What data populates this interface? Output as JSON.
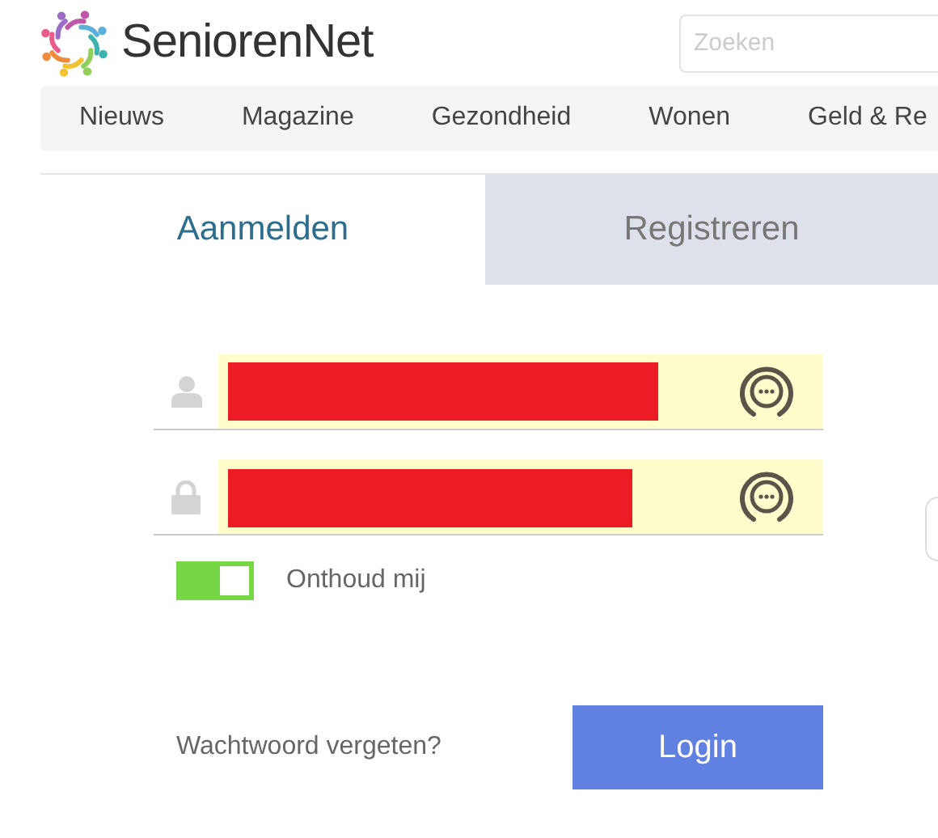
{
  "header": {
    "brand": "SeniorenNet",
    "search": {
      "placeholder": "Zoeken"
    }
  },
  "nav": [
    "Nieuws",
    "Magazine",
    "Gezondheid",
    "Wonen",
    "Geld & Re"
  ],
  "tabs": [
    {
      "label": "Aanmelden",
      "selected": true
    },
    {
      "label": "Registreren",
      "selected": false
    }
  ],
  "fields": [
    {
      "kind": "user",
      "redacted": true
    },
    {
      "kind": "password",
      "redacted": true
    }
  ],
  "remember": {
    "label": "Onthoud mij",
    "on": true
  },
  "forgot_link": "Wachtwoord vergeten?",
  "login_button": "Login"
}
